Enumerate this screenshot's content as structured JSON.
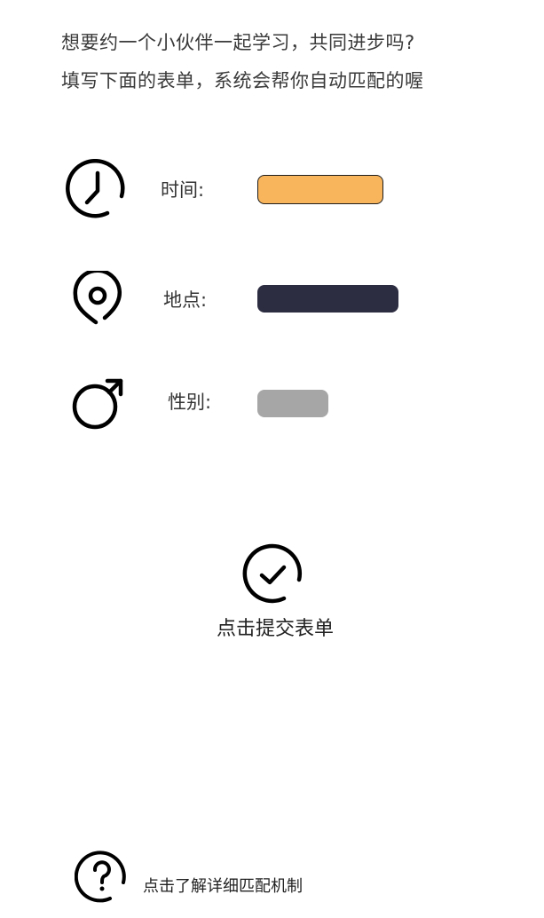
{
  "intro": {
    "line1": "想要约一个小伙伴一起学习，共同进步吗?",
    "line2": "填写下面的表单，系统会帮你自动匹配的喔"
  },
  "form": {
    "time": {
      "icon": "clock-icon",
      "label": "时间:",
      "color": "#f9b55b"
    },
    "location": {
      "icon": "location-pin-icon",
      "label": "地点:",
      "color": "#2d2d42"
    },
    "gender": {
      "icon": "male-icon",
      "label": "性别:",
      "color": "#a6a6a6"
    }
  },
  "submit": {
    "icon": "check-circle-icon",
    "label": "点击提交表单"
  },
  "help": {
    "icon": "question-circle-icon",
    "label": "点击了解详细匹配机制"
  }
}
